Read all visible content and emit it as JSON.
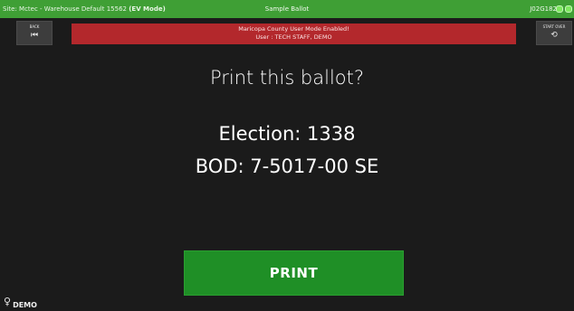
{
  "header": {
    "site_prefix": "Site: Mctec - Warehouse Default 15562 ",
    "site_mode": "(EV Mode)",
    "window_title": "Sample Ballot",
    "device_id": "J02G182"
  },
  "controls": {
    "back_label": "BACK",
    "back_icon": "⏮",
    "start_over_label": "START OVER",
    "start_over_icon": "⟲"
  },
  "alert": {
    "line1": "Maricopa County User Mode Enabled!",
    "line2": "User : TECH STAFF, DEMO"
  },
  "main": {
    "question": "Print this ballot?",
    "election": "Election: 1338",
    "bod": "BOD: 7-5017-00 SE"
  },
  "actions": {
    "print_label": "PRINT"
  },
  "footer": {
    "bulb_icon": "💡",
    "user_label": "DEMO"
  },
  "colors": {
    "topbar": "#3f9f35",
    "alert": "#b3282c",
    "print_button": "#1f8f26",
    "background": "#1b1b1b"
  }
}
